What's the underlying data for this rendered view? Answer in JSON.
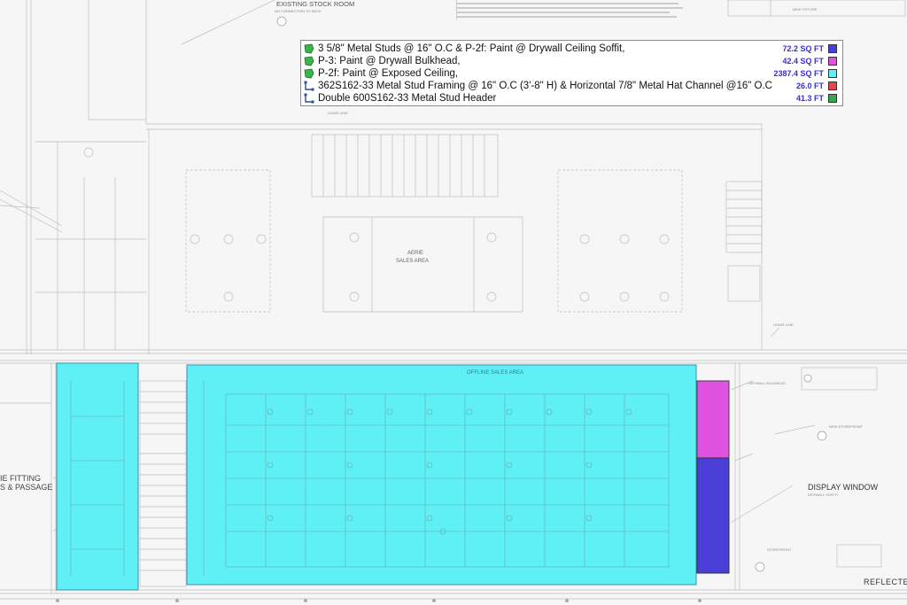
{
  "legend": {
    "rows": [
      {
        "label": "3 5/8\" Metal Studs @ 16\" O.C & P-2f: Paint @ Drywall Ceiling Soffit,",
        "value": "72.2 SQ FT",
        "swatch": "#4b3fd8",
        "value_color": "#3b2fd0",
        "icon": "area-icon"
      },
      {
        "label": "P-3: Paint @ Drywall Bulkhead,",
        "value": "42.4 SQ FT",
        "swatch": "#e052e0",
        "value_color": "#3b2fd0",
        "icon": "area-icon"
      },
      {
        "label": "P-2f: Paint @ Exposed Ceiling,",
        "value": "2387.4 SQ FT",
        "swatch": "#5ff0f5",
        "value_color": "#3b2fd0",
        "icon": "area-icon"
      },
      {
        "label": "362S162-33 Metal Stud Framing @ 16\" O.C (3'-8\" H) & Horizontal 7/8\" Metal Hat Channel @16\" O.C",
        "value": "26.0 FT",
        "swatch": "#e24848",
        "value_color": "#3b2fd0",
        "icon": "linear-icon"
      },
      {
        "label": "Double 600S162-33 Metal Stud Header",
        "value": "41.3 FT",
        "swatch": "#3aa54a",
        "value_color": "#3b2fd0",
        "icon": "linear-icon"
      }
    ]
  },
  "labels": {
    "stock_room": "EXISTING STOCK ROOM",
    "stock_room_sub": "NO CONNECTION TO DECK",
    "aerie": "AERIE",
    "aerie_sub": "SALES AREA",
    "offline": "OFFLINE SALES AREA",
    "display_window": "DISPLAY WINDOW",
    "reflected": "REFLECTED",
    "fitting": "IE FITTING",
    "passage": "S & PASSAGE",
    "new_fixture": "NEW FIXTURE",
    "lease_line": "LEASE LINE",
    "storefront": "STOREFRONT",
    "drywall_bulkhead": "DRYWALL BULKHEAD",
    "drywall_soffit": "DRYWALL SOFFIT",
    "new_storefront": "NEW STOREFRONT"
  },
  "colors": {
    "cyan": "#5ff0f5",
    "magenta": "#e052e0",
    "blue": "#4b3fd8"
  }
}
